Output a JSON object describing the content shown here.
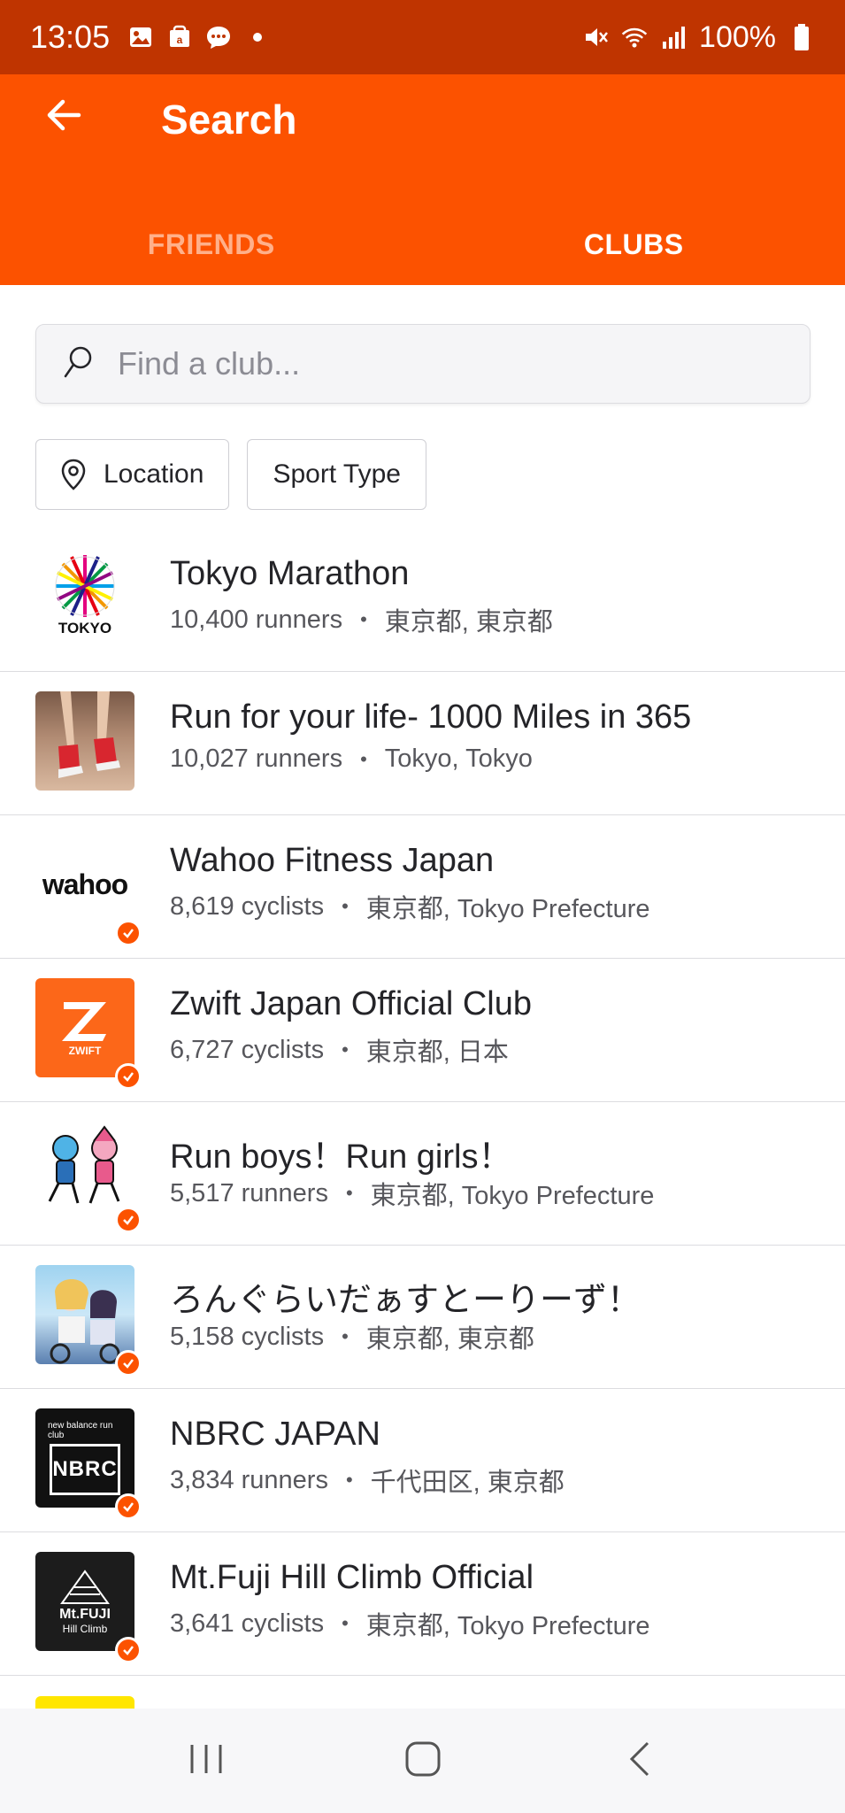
{
  "status_bar": {
    "time": "13:05",
    "battery": "100%",
    "icons_left": [
      "gallery-icon",
      "amazon-icon",
      "chat-icon",
      "dot-icon"
    ],
    "icons_right": [
      "mute-icon",
      "wifi-icon",
      "signal-icon",
      "battery-icon"
    ]
  },
  "app_bar": {
    "title": "Search",
    "back_icon": "arrow-left-icon"
  },
  "tabs": [
    {
      "label": "FRIENDS",
      "selected": false
    },
    {
      "label": "CLUBS",
      "selected": true
    }
  ],
  "search": {
    "placeholder": "Find a club...",
    "value": ""
  },
  "filters": {
    "location_label": "Location",
    "sport_type_label": "Sport Type"
  },
  "clubs": [
    {
      "name": "Tokyo Marathon",
      "count": "10,400 runners",
      "location": "東京都, 東京都",
      "verified": false,
      "logo_text": "TOKYO"
    },
    {
      "name": "Run for your life-  1000 Miles in 365",
      "count": "10,027 runners",
      "location": "Tokyo, Tokyo",
      "verified": false,
      "logo_text": ""
    },
    {
      "name": "Wahoo Fitness Japan",
      "count": "8,619 cyclists",
      "location": "東京都, Tokyo Prefecture",
      "verified": true,
      "logo_text": "wahoo"
    },
    {
      "name": "Zwift Japan Official Club",
      "count": "6,727 cyclists",
      "location": "東京都, 日本",
      "verified": true,
      "logo_text": "ZWIFT"
    },
    {
      "name": "Run boys！Run girls！",
      "count": "5,517 runners",
      "location": "東京都, Tokyo Prefecture",
      "verified": true,
      "logo_text": ""
    },
    {
      "name": "ろんぐらいだぁすとーりーず！",
      "count": "5,158 cyclists",
      "location": "東京都, 東京都",
      "verified": true,
      "logo_text": ""
    },
    {
      "name": "NBRC JAPAN",
      "count": "3,834 runners",
      "location": "千代田区, 東京都",
      "verified": true,
      "logo_text": "NBRC",
      "logo_sub": "new balance run club"
    },
    {
      "name": "Mt.Fuji Hill Climb Official",
      "count": "3,641 cyclists",
      "location": "東京都, Tokyo Prefecture",
      "verified": true,
      "logo_text": "Mt.FUJI",
      "logo_sub": "Hill Climb"
    }
  ],
  "colors": {
    "brand": "#fc5200",
    "status_bar": "#bf3400",
    "text": "#242428",
    "meta_text": "#57575c"
  },
  "nav_bar": {
    "recents_icon": "recents-icon",
    "home_icon": "home-icon",
    "back_icon": "back-icon"
  }
}
